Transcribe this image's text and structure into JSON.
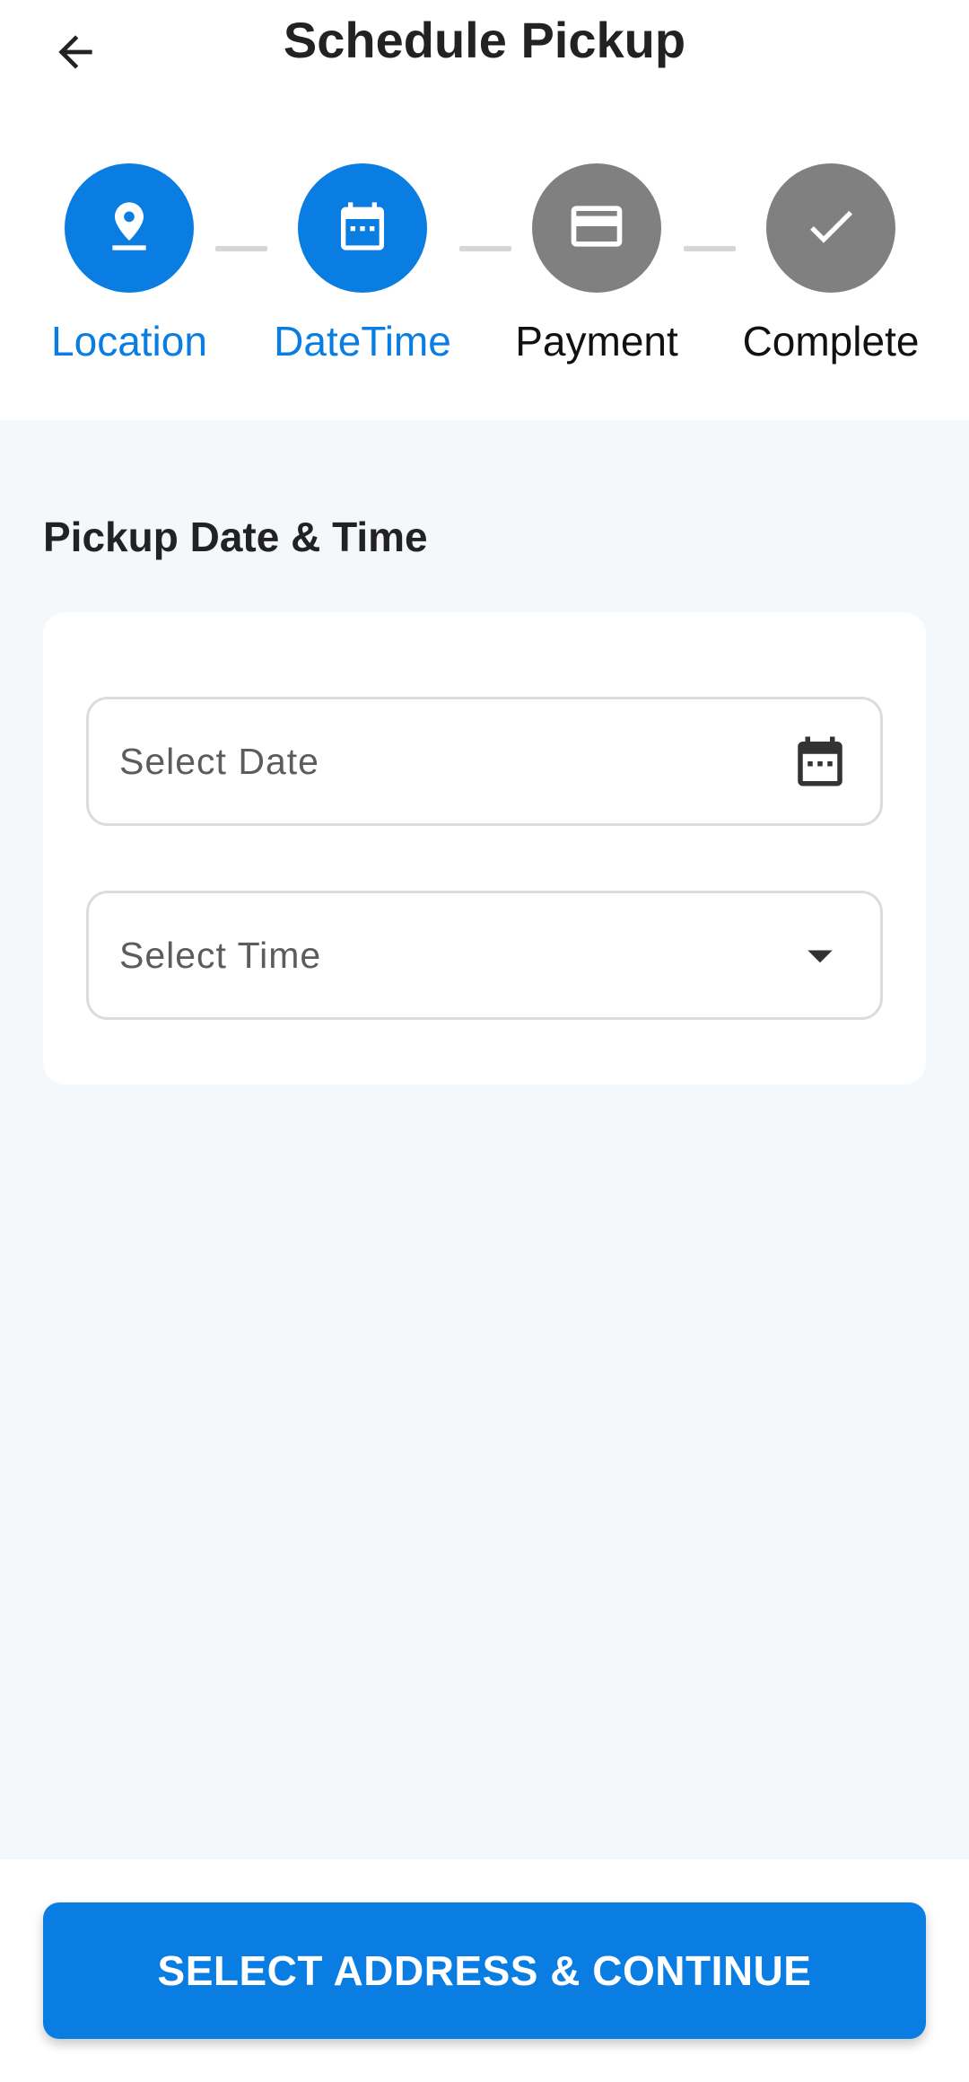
{
  "header": {
    "title": "Schedule Pickup",
    "back_icon": "arrow-left-icon"
  },
  "stepper": {
    "active_color": "#0a7de3",
    "inactive_color": "#808080",
    "connector_color": "#d6d6d6",
    "steps": [
      {
        "label": "Location",
        "icon": "location-pin-icon",
        "state": "completed"
      },
      {
        "label": "DateTime",
        "icon": "calendar-icon",
        "state": "active"
      },
      {
        "label": "Payment",
        "icon": "credit-card-icon",
        "state": "upcoming"
      },
      {
        "label": "Complete",
        "icon": "check-icon",
        "state": "upcoming"
      }
    ]
  },
  "section": {
    "title": "Pickup Date & Time"
  },
  "form": {
    "date_field": {
      "placeholder": "Select Date",
      "icon": "calendar-icon"
    },
    "time_field": {
      "placeholder": "Select Time",
      "icon": "dropdown-arrow-icon"
    }
  },
  "footer": {
    "continue_label": "SELECT ADDRESS & CONTINUE",
    "button_color": "#0a7de3"
  },
  "colors": {
    "page_background": "#f4f8fb",
    "accent": "#0a7de3"
  }
}
